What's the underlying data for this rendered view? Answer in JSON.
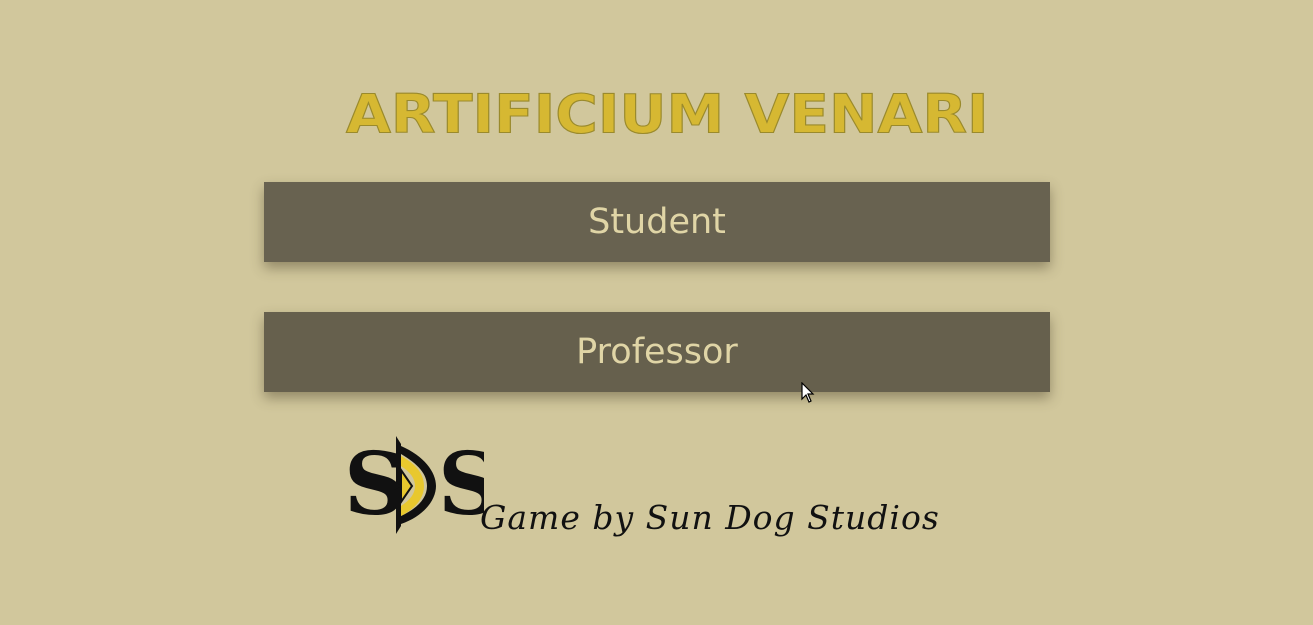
{
  "game": {
    "title": "Artificium Venari"
  },
  "menu": {
    "student_label": "Student",
    "professor_label": "Professor"
  },
  "footer": {
    "logo_text": "SDS",
    "credit": "Game by Sun Dog Studios"
  },
  "colors": {
    "background": "#d1c79c",
    "button": "#686250",
    "button_text": "#e0d5a6",
    "title": "#d6b832",
    "logo_accent": "#e8c82e"
  }
}
